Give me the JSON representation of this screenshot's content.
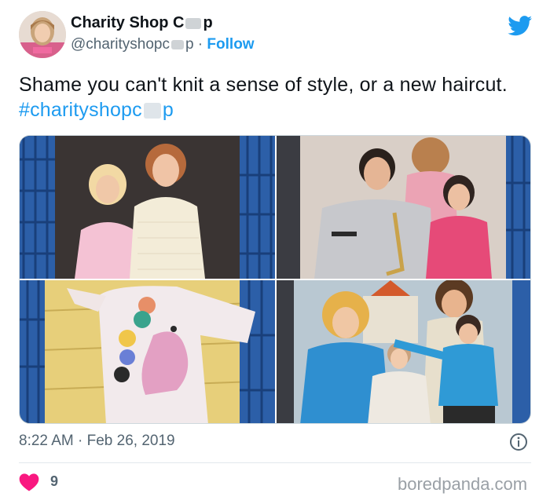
{
  "author": {
    "name_prefix": "Charity Shop C",
    "name_suffix": "p",
    "handle_prefix": "@charityshopc",
    "handle_suffix": "p",
    "separator": " · ",
    "follow_label": "Follow"
  },
  "tweet": {
    "text": "Shame you can't knit a sense of style, or a new haircut. ",
    "hashtag_prefix": "#charityshopc",
    "hashtag_suffix": "p"
  },
  "media": {
    "photos": [
      {
        "subject": "two kids in pastel knit jumpers"
      },
      {
        "subject": "family in knit sweaters with saxophone"
      },
      {
        "subject": "child in white jumper with balloon elephant motif"
      },
      {
        "subject": "family in blue and cream cable knits"
      }
    ]
  },
  "meta": {
    "time": "8:22 AM",
    "separator": " · ",
    "date": "Feb 26, 2019"
  },
  "engagement": {
    "like_count": "9"
  },
  "watermark": "boredpanda.com",
  "colors": {
    "accent": "#1d9bf0",
    "like": "#f91880",
    "muted": "#536471"
  },
  "icons": [
    "twitter-bird-icon",
    "info-icon",
    "heart-icon"
  ]
}
